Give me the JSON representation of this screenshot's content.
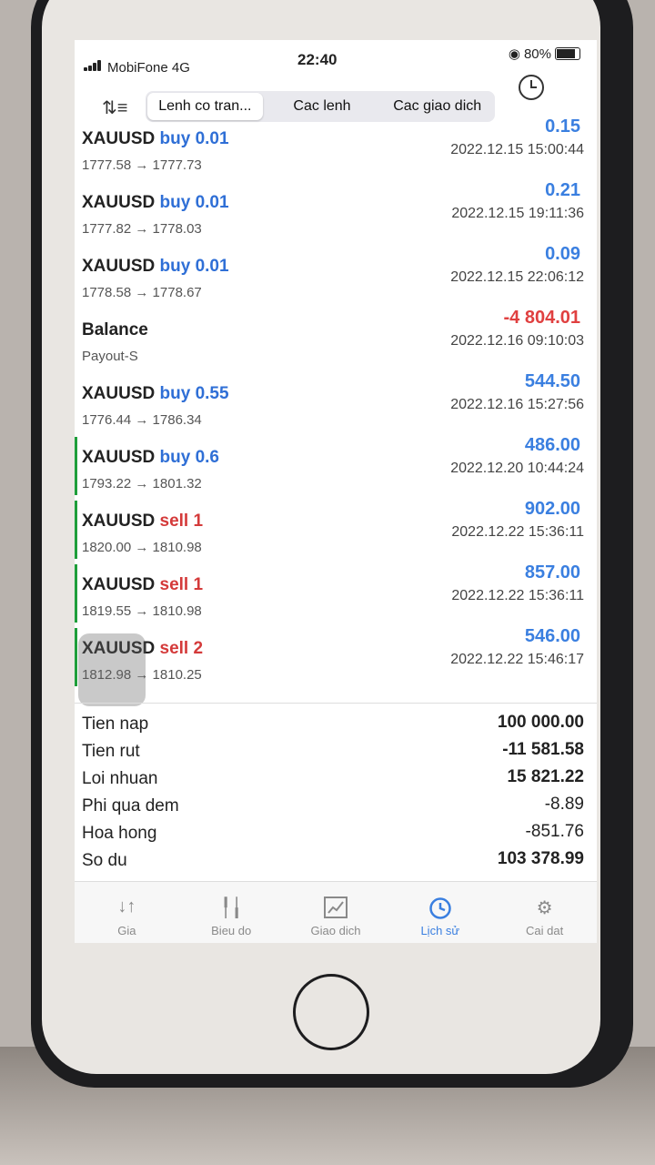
{
  "status": {
    "carrier": "MobiFone 4G",
    "time": "22:40",
    "battery": "80%"
  },
  "toolbar": {
    "segments": [
      "Lenh co tran...",
      "Cac lenh",
      "Cac giao dich"
    ]
  },
  "trades": [
    {
      "symbol": "XAUUSD",
      "side": "buy 0.01",
      "prices": "1777.58 → 1777.73",
      "profit": "0.15",
      "time": "2022.12.15 15:00:44"
    },
    {
      "symbol": "XAUUSD",
      "side": "buy 0.01",
      "prices": "1777.82 → 1778.03",
      "profit": "0.21",
      "time": "2022.12.15 19:11:36"
    },
    {
      "symbol": "XAUUSD",
      "side": "buy 0.01",
      "prices": "1778.58 → 1778.67",
      "profit": "0.09",
      "time": "2022.12.15 22:06:12"
    },
    {
      "symbol": "Balance",
      "side": "",
      "prices": "Payout-S",
      "profit": "-4 804.01",
      "time": "2022.12.16 09:10:03"
    },
    {
      "symbol": "XAUUSD",
      "side": "buy 0.55",
      "prices": "1776.44 → 1786.34",
      "profit": "544.50",
      "time": "2022.12.16 15:27:56"
    },
    {
      "symbol": "XAUUSD",
      "side": "buy 0.6",
      "prices": "1793.22 → 1801.32",
      "profit": "486.00",
      "time": "2022.12.20 10:44:24"
    },
    {
      "symbol": "XAUUSD",
      "side": "sell 1",
      "prices": "1820.00 → 1810.98",
      "profit": "902.00",
      "time": "2022.12.22 15:36:11"
    },
    {
      "symbol": "XAUUSD",
      "side": "sell 1",
      "prices": "1819.55 → 1810.98",
      "profit": "857.00",
      "time": "2022.12.22 15:36:11"
    },
    {
      "symbol": "XAUUSD",
      "side": "sell 2",
      "prices": "1812.98 → 1810.25",
      "profit": "546.00",
      "time": "2022.12.22 15:46:17"
    }
  ],
  "summary": [
    {
      "label": "Tien nap",
      "value": "100 000.00"
    },
    {
      "label": "Tien rut",
      "value": "-11 581.58"
    },
    {
      "label": "Loi nhuan",
      "value": "15 821.22"
    },
    {
      "label": "Phi qua dem",
      "value": "-8.89"
    },
    {
      "label": "Hoa hong",
      "value": "-851.76"
    },
    {
      "label": "So du",
      "value": "103 378.99"
    }
  ],
  "tabs": [
    {
      "label": "Gia",
      "icon": "quotes-icon"
    },
    {
      "label": "Bieu do",
      "icon": "candlestick-icon"
    },
    {
      "label": "Giao dich",
      "icon": "trade-chart-icon"
    },
    {
      "label": "Lịch sử",
      "icon": "history-icon"
    },
    {
      "label": "Cai dat",
      "icon": "gear-icon"
    }
  ],
  "colors": {
    "buy": "#2f6fd6",
    "sell": "#d43a3a",
    "profit": "#3a7fe0",
    "loss": "#e04040",
    "accent": "#1e9e3a"
  }
}
